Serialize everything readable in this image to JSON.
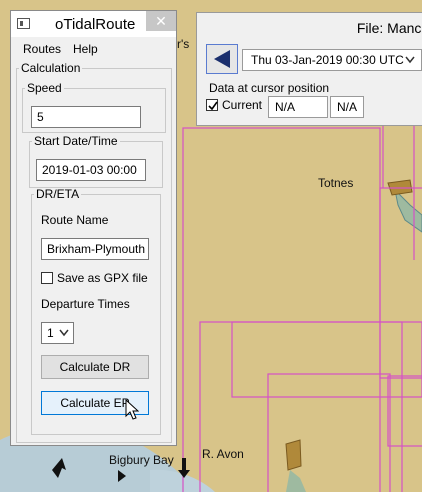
{
  "map": {
    "labels": {
      "totnes": "Totnes",
      "bigbury_bay": "Bigbury Bay",
      "r_avon": "R. Avon",
      "partial_rs": "r's"
    },
    "colors": {
      "land": "#d8c489",
      "sea": "#b7ccd6",
      "chart_lines": "#d552c5",
      "shallow": "#9ebaa0",
      "marker": "#b0893a"
    }
  },
  "info_panel": {
    "title": "File: Manche",
    "time_value": "Thu 03-Jan-2019 00:30  UTC",
    "cursor_label": "Data at cursor position",
    "current_label": "Current",
    "current_checked": true,
    "value_1": "N/A",
    "value_2": "N/A"
  },
  "plugin": {
    "title": "oTidalRoute",
    "close_glyph": "✕",
    "menu": {
      "routes": "Routes",
      "help": "Help"
    },
    "calc_group": "Calculation",
    "speed_group": "Speed",
    "speed_value": "5",
    "start_group": "Start Date/Time",
    "start_value": "2019-01-03  00:00",
    "dreta_group": "DR/ETA",
    "route_name_label": "Route Name",
    "route_name_value": "Brixham-Plymouth",
    "save_gpx_label": "Save as GPX file",
    "save_gpx_checked": false,
    "departure_label": "Departure Times",
    "departure_value": "1",
    "calc_dr_label": "Calculate DR",
    "calc_ep_label": "Calculate EP"
  }
}
